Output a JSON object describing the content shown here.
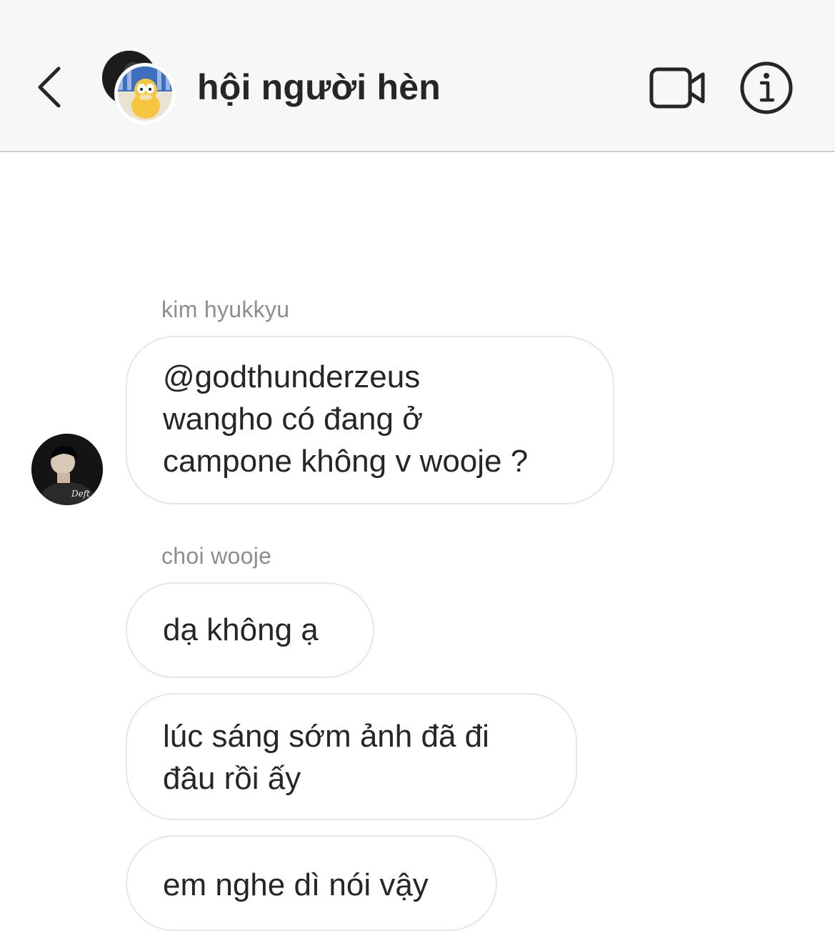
{
  "header": {
    "title": "hội người hèn",
    "back_icon": "chevron-left-icon",
    "video_icon": "video-camera-icon",
    "info_icon": "info-circle-icon"
  },
  "messages": [
    {
      "sender": "kim hyukkyu",
      "bubbles": [
        "@godthunderzeus\nwangho có đang ở\ncampone không v wooje ?"
      ],
      "avatar_caption": "Deft"
    },
    {
      "sender": "choi wooje",
      "bubbles": [
        "dạ không ạ",
        "lúc sáng sớm ảnh đã đi\nđâu rồi ấy",
        "em nghe dì nói vậy"
      ]
    }
  ],
  "colors": {
    "header_bg": "#f7f7f7",
    "bubble_border": "#e6e6e6",
    "text": "#262626",
    "muted": "#8e8e8e"
  }
}
